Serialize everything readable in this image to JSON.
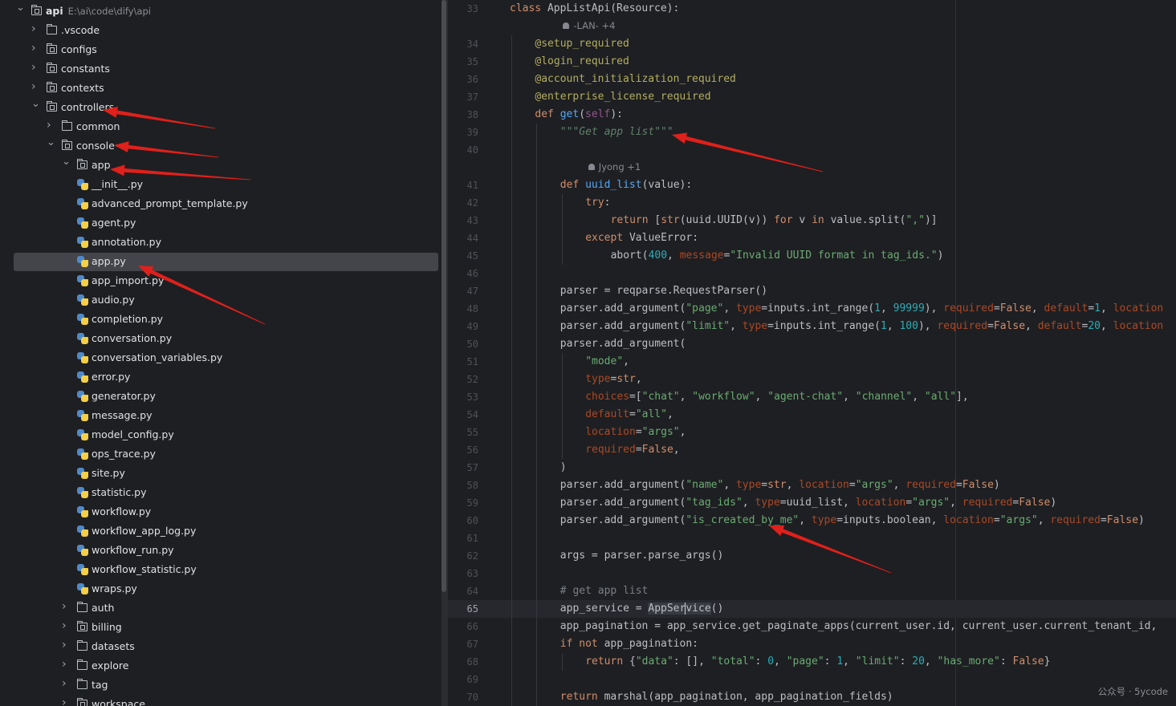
{
  "project_tree": {
    "root": {
      "name": "api",
      "path": "E:\\ai\\code\\dify\\api"
    },
    "items": [
      {
        "label": "api",
        "kind": "root",
        "depth": 0,
        "expanded": true
      },
      {
        "label": ".vscode",
        "kind": "folder",
        "depth": 1,
        "expanded": false
      },
      {
        "label": "configs",
        "kind": "package",
        "depth": 1,
        "expanded": false
      },
      {
        "label": "constants",
        "kind": "package",
        "depth": 1,
        "expanded": false
      },
      {
        "label": "contexts",
        "kind": "package",
        "depth": 1,
        "expanded": false
      },
      {
        "label": "controllers",
        "kind": "package",
        "depth": 1,
        "expanded": true
      },
      {
        "label": "common",
        "kind": "folder",
        "depth": 2,
        "expanded": false
      },
      {
        "label": "console",
        "kind": "package",
        "depth": 2,
        "expanded": true
      },
      {
        "label": "app",
        "kind": "package",
        "depth": 3,
        "expanded": true
      },
      {
        "label": "__init__.py",
        "kind": "file",
        "depth": 4
      },
      {
        "label": "advanced_prompt_template.py",
        "kind": "file",
        "depth": 4
      },
      {
        "label": "agent.py",
        "kind": "file",
        "depth": 4
      },
      {
        "label": "annotation.py",
        "kind": "file",
        "depth": 4
      },
      {
        "label": "app.py",
        "kind": "file",
        "depth": 4,
        "selected": true
      },
      {
        "label": "app_import.py",
        "kind": "file",
        "depth": 4
      },
      {
        "label": "audio.py",
        "kind": "file",
        "depth": 4
      },
      {
        "label": "completion.py",
        "kind": "file",
        "depth": 4
      },
      {
        "label": "conversation.py",
        "kind": "file",
        "depth": 4
      },
      {
        "label": "conversation_variables.py",
        "kind": "file",
        "depth": 4
      },
      {
        "label": "error.py",
        "kind": "file",
        "depth": 4
      },
      {
        "label": "generator.py",
        "kind": "file",
        "depth": 4
      },
      {
        "label": "message.py",
        "kind": "file",
        "depth": 4
      },
      {
        "label": "model_config.py",
        "kind": "file",
        "depth": 4
      },
      {
        "label": "ops_trace.py",
        "kind": "file",
        "depth": 4
      },
      {
        "label": "site.py",
        "kind": "file",
        "depth": 4
      },
      {
        "label": "statistic.py",
        "kind": "file",
        "depth": 4
      },
      {
        "label": "workflow.py",
        "kind": "file",
        "depth": 4
      },
      {
        "label": "workflow_app_log.py",
        "kind": "file",
        "depth": 4
      },
      {
        "label": "workflow_run.py",
        "kind": "file",
        "depth": 4
      },
      {
        "label": "workflow_statistic.py",
        "kind": "file",
        "depth": 4
      },
      {
        "label": "wraps.py",
        "kind": "file",
        "depth": 4
      },
      {
        "label": "auth",
        "kind": "folder",
        "depth": 3,
        "expanded": false
      },
      {
        "label": "billing",
        "kind": "package",
        "depth": 3,
        "expanded": false
      },
      {
        "label": "datasets",
        "kind": "folder",
        "depth": 3,
        "expanded": false
      },
      {
        "label": "explore",
        "kind": "folder",
        "depth": 3,
        "expanded": false
      },
      {
        "label": "tag",
        "kind": "folder",
        "depth": 3,
        "expanded": false
      },
      {
        "label": "workspace",
        "kind": "package",
        "depth": 3,
        "expanded": false
      }
    ]
  },
  "editor": {
    "current_line": 65,
    "author_hints": [
      {
        "after_line": 33,
        "text": "-LAN- +4"
      },
      {
        "after_line": 40,
        "text": "Jyong +1"
      }
    ],
    "lines": [
      {
        "n": 33,
        "indent": 0,
        "tokens": [
          [
            "kw",
            "class "
          ],
          [
            "cls",
            "AppListApi(Resource):"
          ]
        ]
      },
      {
        "n": 34,
        "indent": 1,
        "tokens": [
          [
            "dec",
            "@setup_required"
          ]
        ]
      },
      {
        "n": 35,
        "indent": 1,
        "tokens": [
          [
            "dec",
            "@login_required"
          ]
        ]
      },
      {
        "n": 36,
        "indent": 1,
        "tokens": [
          [
            "dec",
            "@account_initialization_required"
          ]
        ]
      },
      {
        "n": 37,
        "indent": 1,
        "tokens": [
          [
            "dec",
            "@enterprise_license_required"
          ]
        ]
      },
      {
        "n": 38,
        "indent": 1,
        "tokens": [
          [
            "kw",
            "def "
          ],
          [
            "fn",
            "get"
          ],
          [
            "",
            "("
          ],
          [
            "slf",
            "self"
          ],
          [
            "",
            "):"
          ]
        ]
      },
      {
        "n": 39,
        "indent": 2,
        "tokens": [
          [
            "doc",
            "\"\"\"Get app list\"\"\""
          ]
        ]
      },
      {
        "n": 40,
        "indent": 0,
        "tokens": []
      },
      {
        "n": 41,
        "indent": 2,
        "tokens": [
          [
            "kw",
            "def "
          ],
          [
            "fn",
            "uuid_list"
          ],
          [
            "",
            "(value):"
          ]
        ]
      },
      {
        "n": 42,
        "indent": 3,
        "tokens": [
          [
            "kw",
            "try"
          ],
          [
            "",
            ":"
          ]
        ]
      },
      {
        "n": 43,
        "indent": 4,
        "tokens": [
          [
            "kw",
            "return "
          ],
          [
            "",
            "["
          ],
          [
            "kw",
            "str"
          ],
          [
            "",
            "(uuid.UUID(v)) "
          ],
          [
            "kw",
            "for "
          ],
          [
            "",
            "v "
          ],
          [
            "kw",
            "in "
          ],
          [
            "",
            "value.split("
          ],
          [
            "str",
            "\",\""
          ],
          [
            "",
            ")]"
          ]
        ]
      },
      {
        "n": 44,
        "indent": 3,
        "tokens": [
          [
            "kw",
            "except "
          ],
          [
            "",
            "ValueError:"
          ]
        ]
      },
      {
        "n": 45,
        "indent": 4,
        "tokens": [
          [
            "",
            "abort("
          ],
          [
            "num",
            "400"
          ],
          [
            "",
            ", "
          ],
          [
            "prm",
            "message"
          ],
          [
            "",
            "="
          ],
          [
            "str",
            "\"Invalid UUID format in tag_ids.\""
          ],
          [
            "",
            ")"
          ]
        ]
      },
      {
        "n": 46,
        "indent": 0,
        "tokens": []
      },
      {
        "n": 47,
        "indent": 2,
        "tokens": [
          [
            "",
            "parser = reqparse.RequestParser()"
          ]
        ]
      },
      {
        "n": 48,
        "indent": 2,
        "tokens": [
          [
            "",
            "parser.add_argument("
          ],
          [
            "str",
            "\"page\""
          ],
          [
            "",
            ", "
          ],
          [
            "prm",
            "type"
          ],
          [
            "",
            "=inputs.int_range("
          ],
          [
            "num",
            "1"
          ],
          [
            "",
            ", "
          ],
          [
            "num",
            "99999"
          ],
          [
            "",
            "), "
          ],
          [
            "prm",
            "required"
          ],
          [
            "",
            "="
          ],
          [
            "kw",
            "False"
          ],
          [
            "",
            ", "
          ],
          [
            "prm",
            "default"
          ],
          [
            "",
            "="
          ],
          [
            "num",
            "1"
          ],
          [
            "",
            ", "
          ],
          [
            "prm",
            "location"
          ]
        ]
      },
      {
        "n": 49,
        "indent": 2,
        "tokens": [
          [
            "",
            "parser.add_argument("
          ],
          [
            "str",
            "\"limit\""
          ],
          [
            "",
            ", "
          ],
          [
            "prm",
            "type"
          ],
          [
            "",
            "=inputs.int_range("
          ],
          [
            "num",
            "1"
          ],
          [
            "",
            ", "
          ],
          [
            "num",
            "100"
          ],
          [
            "",
            "), "
          ],
          [
            "prm",
            "required"
          ],
          [
            "",
            "="
          ],
          [
            "kw",
            "False"
          ],
          [
            "",
            ", "
          ],
          [
            "prm",
            "default"
          ],
          [
            "",
            "="
          ],
          [
            "num",
            "20"
          ],
          [
            "",
            ", "
          ],
          [
            "prm",
            "location"
          ]
        ]
      },
      {
        "n": 50,
        "indent": 2,
        "tokens": [
          [
            "",
            "parser.add_argument("
          ]
        ]
      },
      {
        "n": 51,
        "indent": 3,
        "tokens": [
          [
            "str",
            "\"mode\""
          ],
          [
            "",
            ","
          ]
        ]
      },
      {
        "n": 52,
        "indent": 3,
        "tokens": [
          [
            "prm",
            "type"
          ],
          [
            "",
            "="
          ],
          [
            "kw",
            "str"
          ],
          [
            "",
            ","
          ]
        ]
      },
      {
        "n": 53,
        "indent": 3,
        "tokens": [
          [
            "prm",
            "choices"
          ],
          [
            "",
            "=["
          ],
          [
            "str",
            "\"chat\""
          ],
          [
            "",
            ", "
          ],
          [
            "str",
            "\"workflow\""
          ],
          [
            "",
            ", "
          ],
          [
            "str",
            "\"agent-chat\""
          ],
          [
            "",
            ", "
          ],
          [
            "str",
            "\"channel\""
          ],
          [
            "",
            ", "
          ],
          [
            "str",
            "\"all\""
          ],
          [
            "",
            "],"
          ]
        ]
      },
      {
        "n": 54,
        "indent": 3,
        "tokens": [
          [
            "prm",
            "default"
          ],
          [
            "",
            "="
          ],
          [
            "str",
            "\"all\""
          ],
          [
            "",
            ","
          ]
        ]
      },
      {
        "n": 55,
        "indent": 3,
        "tokens": [
          [
            "prm",
            "location"
          ],
          [
            "",
            "="
          ],
          [
            "str",
            "\"args\""
          ],
          [
            "",
            ","
          ]
        ]
      },
      {
        "n": 56,
        "indent": 3,
        "tokens": [
          [
            "prm",
            "required"
          ],
          [
            "",
            "="
          ],
          [
            "kw",
            "False"
          ],
          [
            "",
            ","
          ]
        ]
      },
      {
        "n": 57,
        "indent": 2,
        "tokens": [
          [
            "",
            ")"
          ]
        ]
      },
      {
        "n": 58,
        "indent": 2,
        "tokens": [
          [
            "",
            "parser.add_argument("
          ],
          [
            "str",
            "\"name\""
          ],
          [
            "",
            ", "
          ],
          [
            "prm",
            "type"
          ],
          [
            "",
            "="
          ],
          [
            "kw",
            "str"
          ],
          [
            "",
            ", "
          ],
          [
            "prm",
            "location"
          ],
          [
            "",
            "="
          ],
          [
            "str",
            "\"args\""
          ],
          [
            "",
            ", "
          ],
          [
            "prm",
            "required"
          ],
          [
            "",
            "="
          ],
          [
            "kw",
            "False"
          ],
          [
            "",
            ")"
          ]
        ]
      },
      {
        "n": 59,
        "indent": 2,
        "tokens": [
          [
            "",
            "parser.add_argument("
          ],
          [
            "str",
            "\"tag_ids\""
          ],
          [
            "",
            ", "
          ],
          [
            "prm",
            "type"
          ],
          [
            "",
            "=uuid_list, "
          ],
          [
            "prm",
            "location"
          ],
          [
            "",
            "="
          ],
          [
            "str",
            "\"args\""
          ],
          [
            "",
            ", "
          ],
          [
            "prm",
            "required"
          ],
          [
            "",
            "="
          ],
          [
            "kw",
            "False"
          ],
          [
            "",
            ")"
          ]
        ]
      },
      {
        "n": 60,
        "indent": 2,
        "tokens": [
          [
            "",
            "parser.add_argument("
          ],
          [
            "str",
            "\"is_created_by_me\""
          ],
          [
            "",
            ", "
          ],
          [
            "prm",
            "type"
          ],
          [
            "",
            "=inputs.boolean, "
          ],
          [
            "prm",
            "location"
          ],
          [
            "",
            "="
          ],
          [
            "str",
            "\"args\""
          ],
          [
            "",
            ", "
          ],
          [
            "prm",
            "required"
          ],
          [
            "",
            "="
          ],
          [
            "kw",
            "False"
          ],
          [
            "",
            ")"
          ]
        ]
      },
      {
        "n": 61,
        "indent": 0,
        "tokens": []
      },
      {
        "n": 62,
        "indent": 2,
        "tokens": [
          [
            "",
            "args = parser.parse_args()"
          ]
        ]
      },
      {
        "n": 63,
        "indent": 0,
        "tokens": []
      },
      {
        "n": 64,
        "indent": 2,
        "tokens": [
          [
            "cmt",
            "# get app list"
          ]
        ]
      },
      {
        "n": 65,
        "indent": 2,
        "tokens": [
          [
            "",
            "app_service = "
          ],
          [
            "hl",
            "AppSer"
          ],
          [
            "caret",
            ""
          ],
          [
            "hl",
            "vice"
          ],
          [
            "",
            "()"
          ]
        ]
      },
      {
        "n": 66,
        "indent": 2,
        "tokens": [
          [
            "",
            "app_pagination = app_service.get_paginate_apps(current_user.id, current_user.current_tenant_id,"
          ]
        ]
      },
      {
        "n": 67,
        "indent": 2,
        "tokens": [
          [
            "kw",
            "if not "
          ],
          [
            "",
            "app_pagination:"
          ]
        ]
      },
      {
        "n": 68,
        "indent": 3,
        "tokens": [
          [
            "kw",
            "return "
          ],
          [
            "",
            "{"
          ],
          [
            "str",
            "\"data\""
          ],
          [
            "",
            ": [], "
          ],
          [
            "str",
            "\"total\""
          ],
          [
            "",
            ": "
          ],
          [
            "num",
            "0"
          ],
          [
            "",
            ", "
          ],
          [
            "str",
            "\"page\""
          ],
          [
            "",
            ": "
          ],
          [
            "num",
            "1"
          ],
          [
            "",
            ", "
          ],
          [
            "str",
            "\"limit\""
          ],
          [
            "",
            ": "
          ],
          [
            "num",
            "20"
          ],
          [
            "",
            ", "
          ],
          [
            "str",
            "\"has_more\""
          ],
          [
            "",
            ": "
          ],
          [
            "kw",
            "False"
          ],
          [
            "",
            "}"
          ]
        ]
      },
      {
        "n": 69,
        "indent": 0,
        "tokens": []
      },
      {
        "n": 70,
        "indent": 2,
        "tokens": [
          [
            "kw",
            "return "
          ],
          [
            "",
            "marshal(app_pagination, app_pagination_fields)"
          ]
        ]
      }
    ]
  },
  "watermark": "公众号 · 5ycode",
  "colors": {
    "annotation_arrow": "#e0201b",
    "selection": "#43454a",
    "background": "#1e1f22"
  }
}
